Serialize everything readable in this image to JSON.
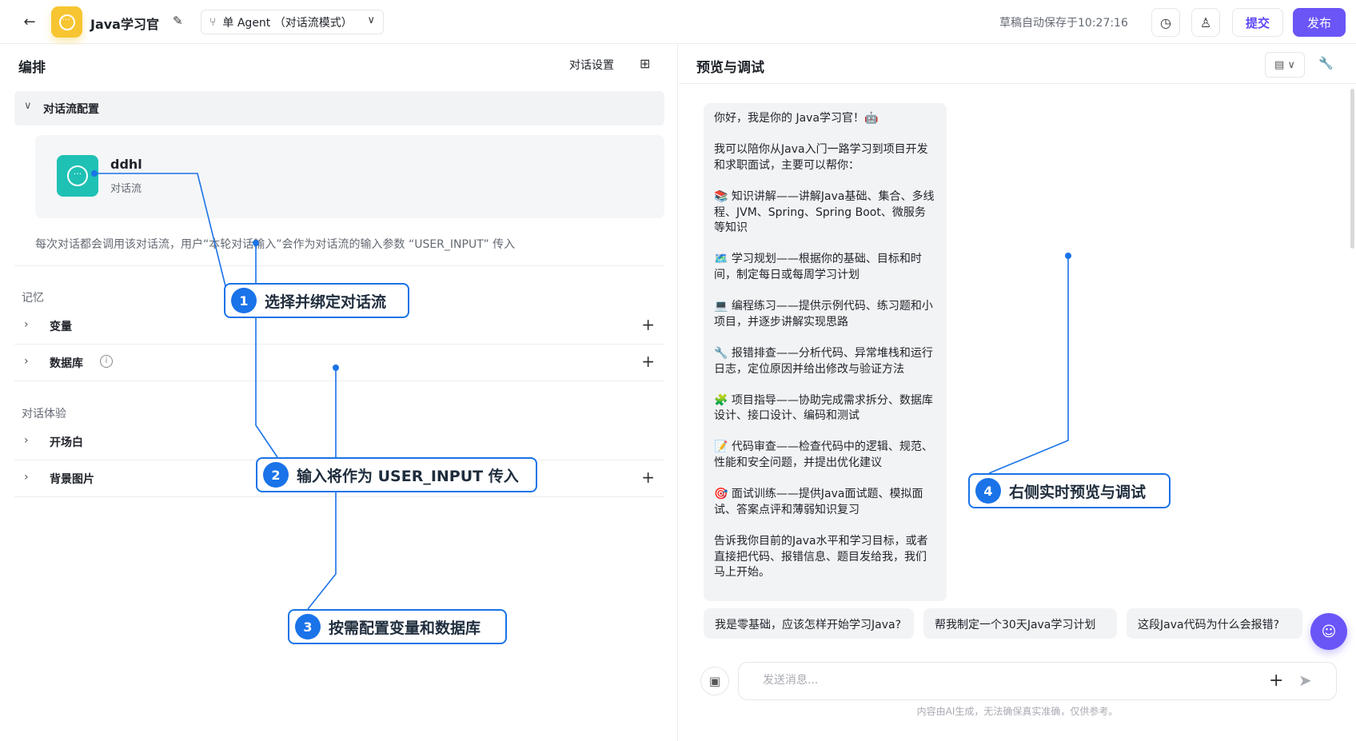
{
  "header": {
    "back": "←",
    "app_title": "Java学习官",
    "mode_label": "单 Agent （对话流模式）",
    "autosave": "草稿自动保存于10:27:16",
    "submit_label": "提交",
    "publish_label": "发布"
  },
  "left": {
    "title": "编排",
    "dialog_settings": "对话设置",
    "flow_section_label": "对话流配置",
    "flow_name": "ddhl",
    "flow_type": "对话流",
    "flow_desc": "每次对话都会调用该对话流，用户“本轮对话输入”会作为对话流的输入参数 “USER_INPUT” 传入",
    "memory_title": "记忆",
    "variables_label": "变量",
    "database_label": "数据库",
    "experience_title": "对话体验",
    "opening_label": "开场白",
    "bg_label": "背景图片"
  },
  "right": {
    "title": "预览与调试",
    "message": [
      "你好，我是你的 Java学习官！🤖",
      "我可以陪你从Java入门一路学习到项目开发和求职面试，主要可以帮你：",
      "📚 知识讲解——讲解Java基础、集合、多线程、JVM、Spring、Spring Boot、微服务等知识",
      "🗺️ 学习规划——根据你的基础、目标和时间，制定每日或每周学习计划",
      "💻 编程练习——提供示例代码、练习题和小项目，并逐步讲解实现思路",
      "🔧 报错排查——分析代码、异常堆栈和运行日志，定位原因并给出修改与验证方法",
      "🧩 项目指导——协助完成需求拆分、数据库设计、接口设计、编码和测试",
      "📝 代码审查——检查代码中的逻辑、规范、性能和安全问题，并提出优化建议",
      "🎯 面试训练——提供Java面试题、模拟面试、答案点评和薄弱知识复习",
      "告诉我你目前的Java水平和学习目标，或者直接把代码、报错信息、题目发给我，我们马上开始。"
    ],
    "suggestions": [
      "我是零基础，应该怎样开始学习Java?",
      "帮我制定一个30天Java学习计划",
      "这段Java代码为什么会报错?"
    ],
    "input_placeholder": "发送消息...",
    "input_value": "",
    "disclaimer": "内容由AI生成，无法确保真实准确，仅供参考。"
  },
  "annotations": [
    {
      "num": "1",
      "text": "选择并绑定对话流"
    },
    {
      "num": "2",
      "text": "输入将作为 USER_INPUT 传入"
    },
    {
      "num": "3",
      "text": "按需配置变量和数据库"
    },
    {
      "num": "4",
      "text": "右侧实时预览与调试"
    }
  ],
  "icons": {
    "back": "arrow-left-icon",
    "edit": "pencil-icon",
    "branch": "branch-icon",
    "history": "clock-icon",
    "user": "user-icon",
    "grid": "grid-icon",
    "wrench": "wrench-icon",
    "send": "send-icon"
  },
  "colors": {
    "accent": "#6a55f7",
    "annotation": "#1a73e8",
    "flow_icon": "#1ec1b4",
    "app_icon": "#f7c531"
  }
}
